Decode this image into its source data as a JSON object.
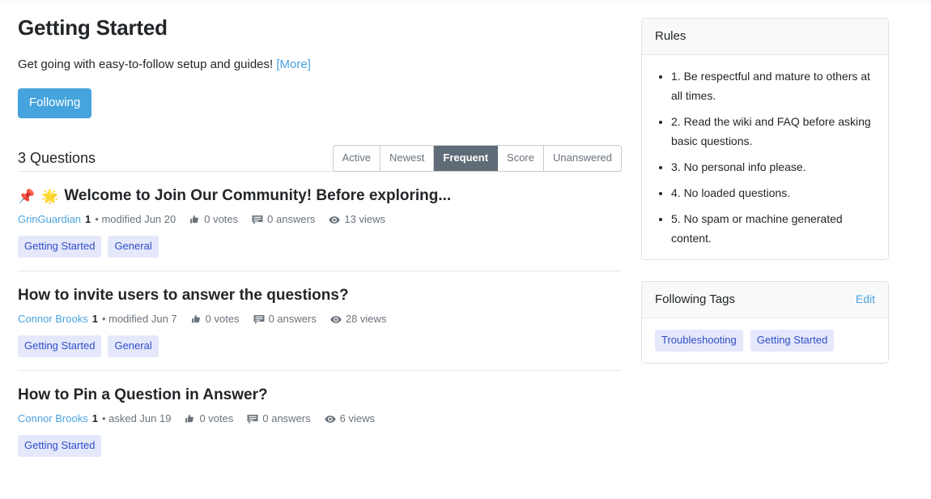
{
  "header": {
    "title": "Getting Started",
    "subtitle": "Get going with easy-to-follow setup and guides!",
    "more_label": "[More]",
    "follow_label": "Following",
    "accent_color": "#45a3dd"
  },
  "questions_section": {
    "count_label": "3 Questions",
    "tabs": [
      {
        "label": "Active",
        "active": false
      },
      {
        "label": "Newest",
        "active": false
      },
      {
        "label": "Frequent",
        "active": true
      },
      {
        "label": "Score",
        "active": false
      },
      {
        "label": "Unanswered",
        "active": false
      }
    ],
    "active_tab_color": "#5f6b76",
    "items": [
      {
        "pin_icon": "pushpin-icon",
        "pin_glyph": "📌",
        "star_icon": "glowing-star-icon",
        "star_glyph": "🌟",
        "title": "Welcome to Join Our Community! Before exploring...",
        "author": "GrinGuardian",
        "reputation": "1",
        "date": "• modified Jun 20",
        "votes": "0 votes",
        "answers": "0 answers",
        "views": "13 views",
        "tags": [
          "Getting Started",
          "General"
        ]
      },
      {
        "pin_icon": null,
        "pin_glyph": "",
        "star_icon": null,
        "star_glyph": "",
        "title": "How to invite users to answer the questions?",
        "author": "Connor Brooks",
        "reputation": "1",
        "date": "• modified Jun 7",
        "votes": "0 votes",
        "answers": "0 answers",
        "views": "28 views",
        "tags": [
          "Getting Started",
          "General"
        ]
      },
      {
        "pin_icon": null,
        "pin_glyph": "",
        "star_icon": null,
        "star_glyph": "",
        "title": "How to Pin a Question in Answer?",
        "author": "Connor Brooks",
        "reputation": "1",
        "date": "• asked Jun 19",
        "votes": "0 votes",
        "answers": "0 answers",
        "views": "6 views",
        "tags": [
          "Getting Started"
        ]
      }
    ]
  },
  "sidebar": {
    "rules_card": {
      "title": "Rules",
      "items": [
        "1. Be respectful and mature to others at all times.",
        "2. Read the wiki and FAQ before asking basic questions.",
        "3. No personal info please.",
        "4. No loaded questions.",
        "5. No spam or machine generated content."
      ]
    },
    "tags_card": {
      "title": "Following Tags",
      "edit_label": "Edit",
      "tags": [
        "Troubleshooting",
        "Getting Started"
      ],
      "tag_bg": "#e5e8fb",
      "tag_color": "#2f4ec6"
    }
  }
}
